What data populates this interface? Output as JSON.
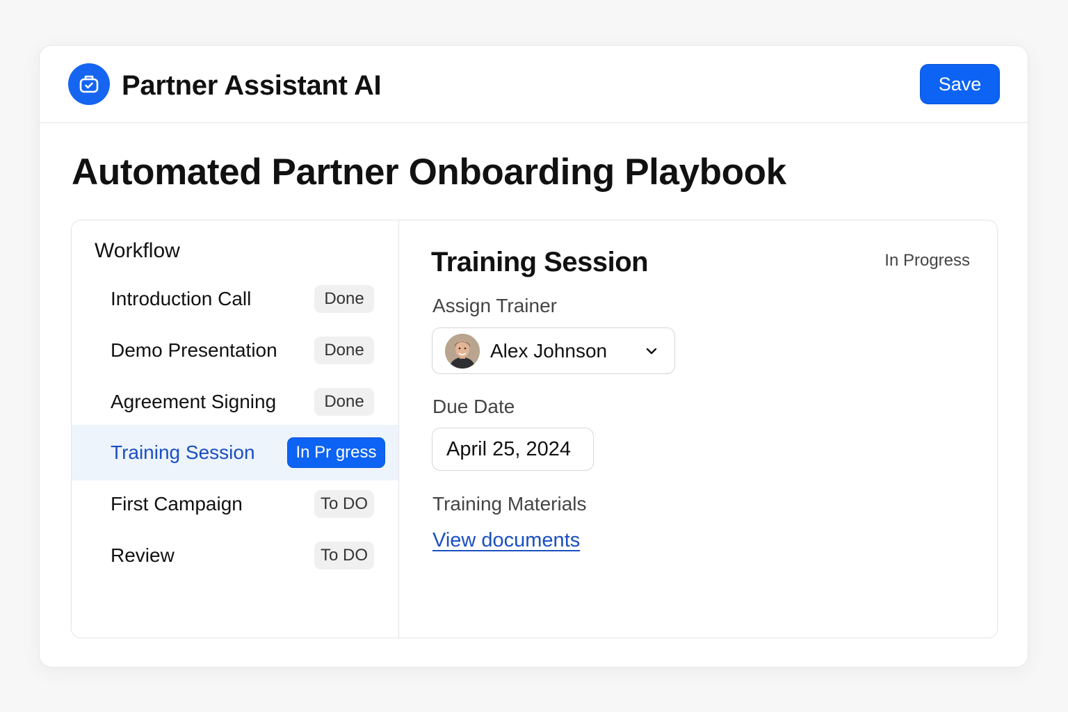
{
  "header": {
    "app_title": "Partner Assistant AI",
    "save_label": "Save"
  },
  "page_title": "Automated Partner Onboarding Playbook",
  "sidebar": {
    "heading": "Workflow",
    "items": [
      {
        "label": "Introduction Call",
        "status": "Done"
      },
      {
        "label": "Demo Presentation",
        "status": "Done"
      },
      {
        "label": "Agreement Signing",
        "status": "Done"
      },
      {
        "label": "Training Session",
        "status": "In Pr gress"
      },
      {
        "label": "First Campaign",
        "status": "To DO"
      },
      {
        "label": "Review",
        "status": "To DO"
      }
    ]
  },
  "detail": {
    "title": "Training Session",
    "status": "In Progress",
    "assign_trainer_label": "Assign Trainer",
    "trainer_name": "Alex Johnson",
    "due_date_label": "Due Date",
    "due_date_value": "April 25, 2024",
    "materials_label": "Training Materials",
    "materials_link": "View documents"
  },
  "colors": {
    "accent": "#0d63f3",
    "active_row_bg": "#eef4fc",
    "link": "#1a4fc0"
  },
  "icons": {
    "logo": "robot-icon",
    "dropdown": "chevron-down-icon"
  }
}
